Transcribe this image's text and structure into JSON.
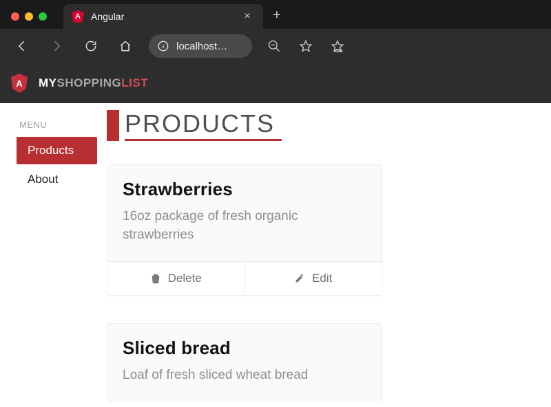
{
  "browser": {
    "tab_title": "Angular",
    "url": "localhost…"
  },
  "brand": {
    "my": "MY",
    "shopping": "SHOPPING",
    "list": "LIST"
  },
  "sidebar": {
    "heading": "MENU",
    "items": [
      {
        "label": "Products",
        "active": true
      },
      {
        "label": "About",
        "active": false
      }
    ]
  },
  "page": {
    "title": "PRODUCTS"
  },
  "actions": {
    "delete": "Delete",
    "edit": "Edit"
  },
  "products": [
    {
      "name": "Strawberries",
      "description": "16oz package of fresh organic strawberries"
    },
    {
      "name": "Sliced bread",
      "description": "Loaf of fresh sliced wheat bread"
    }
  ]
}
